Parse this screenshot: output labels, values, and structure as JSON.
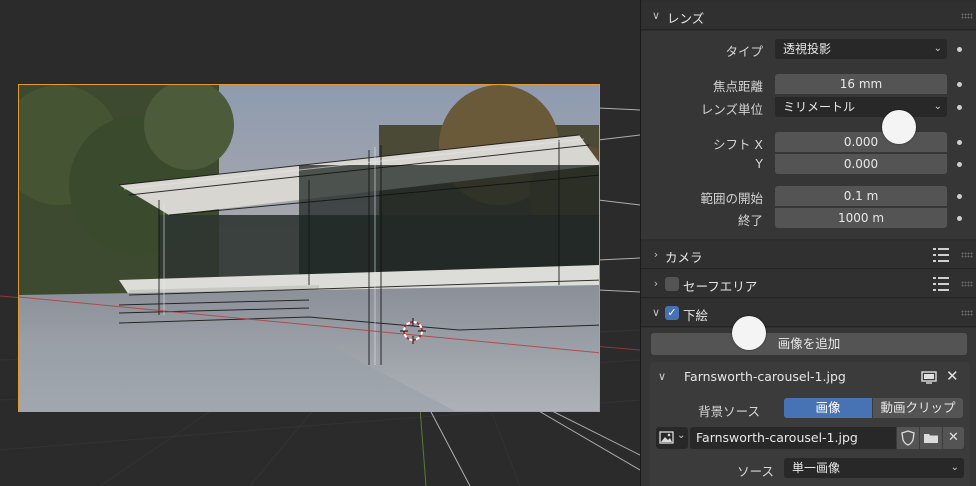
{
  "lens": {
    "header": "レンズ",
    "type_label": "タイプ",
    "type_value": "透視投影",
    "focal_label": "焦点距離",
    "focal_value": "16 mm",
    "lens_unit_label": "レンズ単位",
    "lens_unit_value": "ミリメートル",
    "shift_x_label": "シフト X",
    "shift_x_value": "0.000",
    "shift_y_label": "Y",
    "shift_y_value": "0.000",
    "clip_start_label": "範囲の開始",
    "clip_start_value": "0.1 m",
    "clip_end_label": "終了",
    "clip_end_value": "1000 m"
  },
  "camera_section": {
    "header": "カメラ"
  },
  "safe_areas": {
    "header": "セーフエリア",
    "enabled": false
  },
  "background_images": {
    "header": "下絵",
    "enabled": true,
    "add_image_label": "画像を追加",
    "image_name": "Farnsworth-carousel-1.jpg",
    "source_label": "背景ソース",
    "source_options": [
      "画像",
      "動画クリップ"
    ],
    "source_selected": "画像",
    "image_field_value": "Farnsworth-carousel-1.jpg",
    "source_type_label": "ソース",
    "source_type_value": "単一画像"
  },
  "icons": {
    "expand": "chevron-down-icon",
    "collapse": "chevron-right-icon",
    "list": "list-icon",
    "monitor": "monitor-icon",
    "close": "close-icon",
    "shield": "fake-user-shield-icon",
    "folder": "folder-icon",
    "image": "image-icon"
  },
  "colors": {
    "accent_blue": "#4772b3",
    "camera_frame": "#e39a33",
    "panel_bg": "#2e2e2e"
  }
}
